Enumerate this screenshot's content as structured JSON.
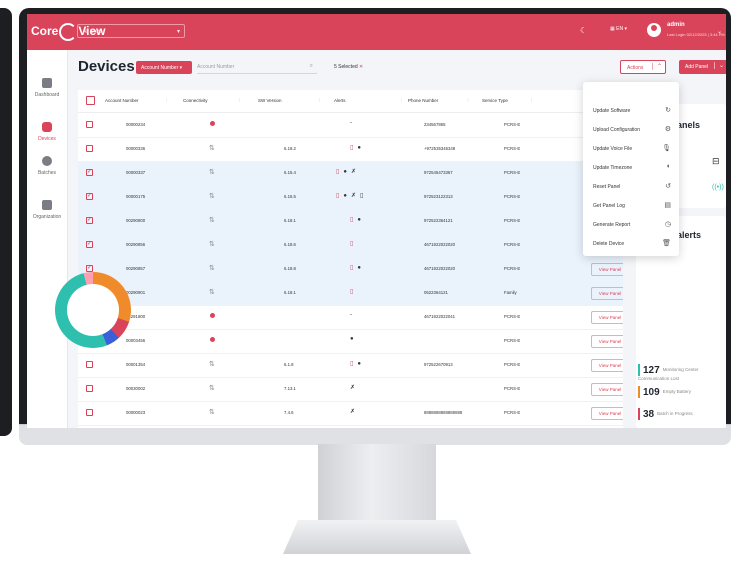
{
  "app": {
    "logo_left": "Core",
    "logo_right": "View",
    "unit_select": "All Units",
    "lang": "EN",
    "user_name": "admin",
    "user_last_login": "Last Login 02/12/2025 | 3:44 PM"
  },
  "sidebar": {
    "items": [
      {
        "label": "Dashboard"
      },
      {
        "label": "Devices"
      },
      {
        "label": "Batches"
      },
      {
        "label": "Organization"
      }
    ]
  },
  "header": {
    "title": "Devices",
    "filter_label": "Account Number",
    "search_placeholder": "Account Number",
    "selected_count": "5 Selected",
    "actions_label": "Actions",
    "add_panel_label": "Add Panel"
  },
  "table": {
    "columns": [
      "Account Number",
      "Connectivity",
      "SW Version",
      "Alerts",
      "Phone Number",
      "Service Type"
    ],
    "view_label": "View Panel",
    "rows": [
      {
        "account": "00000234",
        "conn": "off",
        "sw": "",
        "alerts": "-",
        "phone": "234567865",
        "service": "PCRS-E",
        "checked": false
      },
      {
        "account": "00000336",
        "conn": "on",
        "sw": "6.18.2",
        "alerts": "r2",
        "phone": "+972535346348",
        "service": "PCRS-E",
        "checked": false
      },
      {
        "account": "00000337",
        "conn": "on",
        "sw": "6.15.4",
        "alerts": "r3",
        "phone": "972545473367",
        "service": "PCRS-E",
        "checked": true
      },
      {
        "account": "00000175",
        "conn": "on",
        "sw": "6.15.5",
        "alerts": "r4",
        "phone": "972523122313",
        "service": "PCRS-E",
        "checked": true
      },
      {
        "account": "00290800",
        "conn": "on",
        "sw": "6.18.1",
        "alerts": "r2",
        "phone": "972522364121",
        "service": "PCRS-E",
        "checked": true
      },
      {
        "account": "00290856",
        "conn": "on",
        "sw": "6.18.6",
        "alerts": "r1",
        "phone": "4671922022020",
        "service": "PCRS-E",
        "checked": true
      },
      {
        "account": "00290857",
        "conn": "on",
        "sw": "6.18.8",
        "alerts": "r2",
        "phone": "4671922022020",
        "service": "PCRS-E",
        "checked": true
      },
      {
        "account": "00290901",
        "conn": "on",
        "sw": "6.18.1",
        "alerts": "r1",
        "phone": "0522364121",
        "service": "Family",
        "checked": true
      },
      {
        "account": "00291800",
        "conn": "off",
        "sw": "",
        "alerts": "-",
        "phone": "4671922022041",
        "service": "PCRS-E",
        "checked": false
      },
      {
        "account": "00003456",
        "conn": "off",
        "sw": "",
        "alerts": "b",
        "phone": "",
        "service": "PCRS-E",
        "checked": false
      },
      {
        "account": "00001354",
        "conn": "on",
        "sw": "6.1.8",
        "alerts": "r2",
        "phone": "972522670913",
        "service": "PCRS-E",
        "checked": false
      },
      {
        "account": "00030002",
        "conn": "on",
        "sw": "7.13.1",
        "alerts": "x",
        "phone": "",
        "service": "PCRS-E",
        "checked": false
      },
      {
        "account": "00000023",
        "conn": "on",
        "sw": "7.4.6",
        "alerts": "x",
        "phone": "8888888888888888",
        "service": "PCRS-E",
        "checked": false
      }
    ]
  },
  "actions_menu": {
    "items": [
      {
        "label": "Update Software",
        "icon": "refresh-icon"
      },
      {
        "label": "Upload Configuration",
        "icon": "settings-icon"
      },
      {
        "label": "Update Voice File",
        "icon": "mic-icon"
      },
      {
        "label": "Update Timezone",
        "icon": "globe-icon"
      },
      {
        "label": "Reset Panel",
        "icon": "reset-icon"
      },
      {
        "label": "Get Panel Log",
        "icon": "log-icon"
      },
      {
        "label": "Generate Report",
        "icon": "clock-icon"
      },
      {
        "label": "Delete Device",
        "icon": "trash-icon"
      }
    ]
  },
  "right_panel": {
    "panels_title": "f panels",
    "alerts_title": "th alerts",
    "stats": [
      {
        "value": "127",
        "label": "Monitoring Center Communication Lost",
        "color": "#2fbfae"
      },
      {
        "value": "109",
        "label": "Empty Battery",
        "color": "#f08b2b"
      },
      {
        "value": "38",
        "label": "Batch in Progress",
        "color": "#d9445a"
      }
    ]
  }
}
